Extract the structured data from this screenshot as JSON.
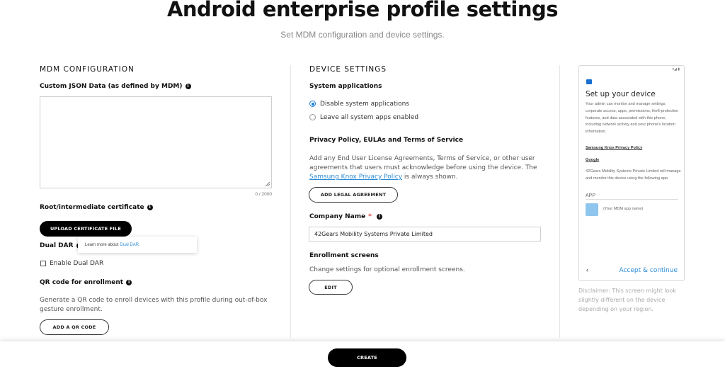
{
  "header": {
    "title": "Android enterprise profile settings",
    "subtitle": "Set MDM configuration and device settings."
  },
  "mdm": {
    "heading": "MDM CONFIGURATION",
    "custom_json_label": "Custom JSON Data (as defined by MDM)",
    "custom_json_value": "",
    "char_count": "0 / 2000",
    "certificate_label": "Root/intermediate certificate",
    "upload_button": "UPLOAD CERTIFICATE FILE",
    "dual_dar_label": "Dual DAR",
    "tooltip_text": "Learn more about",
    "tooltip_link": "Dual DAR.",
    "enable_dual_dar_label": "Enable Dual DAR",
    "enable_dual_dar_checked": false,
    "qr_label": "QR code for enrollment",
    "qr_desc": "Generate a QR code to enroll devices with this profile during out-of-box gesture enrollment.",
    "add_qr_button": "ADD A QR CODE"
  },
  "device": {
    "heading": "DEVICE SETTINGS",
    "system_apps_label": "System applications",
    "options": [
      {
        "label": "Disable system applications",
        "selected": true
      },
      {
        "label": "Leave all system apps enabled",
        "selected": false
      }
    ],
    "privacy_label": "Privacy Policy, EULAs and Terms of Service",
    "privacy_desc_1": "Add any End User License Agreements, Terms of Service, or other user agreements that users must acknowledge before using the device. The",
    "privacy_link": "Samsung Knox Privacy Policy",
    "privacy_desc_2": "is always shown.",
    "add_legal_button": "ADD LEGAL AGREEMENT",
    "company_label": "Company Name",
    "company_required": "*",
    "company_value": "42Gears Mobility Systems Private Limited",
    "enrollment_label": "Enrollment screens",
    "enrollment_desc": "Change settings for optional enrollment screens.",
    "edit_button": "EDIT"
  },
  "preview": {
    "status": "▾◢ ▮",
    "title": "Set up your device",
    "desc": "Your admin can monitor and manage settings, corporate access, apps, permissions, theft-protection features, and data associated with this phone, including network activity and your phone's location information.",
    "knox_link": "Samsung Knox Privacy Policy",
    "google_link": "Google",
    "manage_text": "42Gears Mobility Systems Private Limited will manage and monitor this device using the following app.",
    "app_label": "APP",
    "app_name": "(Your MDM app name)",
    "back": "‹",
    "accept": "Accept & continue",
    "disclaimer": "Disclaimer: This screen might look slightly different on the device depending on your region."
  },
  "footer": {
    "create_button": "CREATE"
  },
  "colors": {
    "accent": "#2a8bd6",
    "radio": "#1a7fd6",
    "primary_button": "#000000"
  }
}
